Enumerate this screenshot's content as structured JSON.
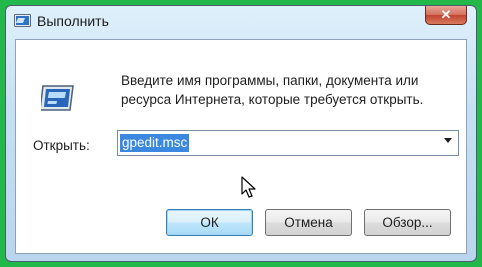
{
  "window": {
    "title": "Выполнить",
    "close_label": "✕"
  },
  "dialog": {
    "description_line1": "Введите имя программы, папки, документа или",
    "description_line2": "ресурса Интернета, которые требуется открыть.",
    "open_label": "Открыть:",
    "open_value": "gpedit.msc"
  },
  "buttons": {
    "ok": "ОК",
    "cancel": "Отмена",
    "browse": "Обзор..."
  },
  "colors": {
    "outer_frame": "#22b84a",
    "selection": "#3a88e0"
  },
  "icons": {
    "app": "run-app-icon",
    "run": "run-program-icon",
    "dropdown": "chevron-down-icon",
    "cursor": "mouse-cursor-icon"
  }
}
